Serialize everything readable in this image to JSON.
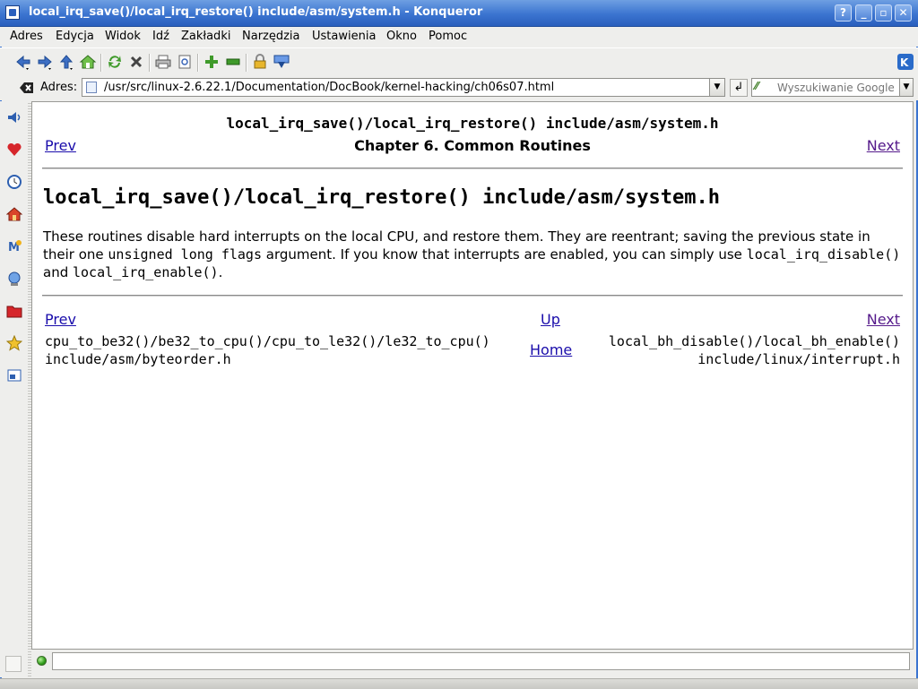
{
  "window": {
    "title": "local_irq_save()/local_irq_restore() include/asm/system.h - Konqueror",
    "buttons": {
      "help": "?",
      "minimize": "_",
      "maximize": "▫",
      "close": "✕"
    }
  },
  "menu": [
    {
      "label": "Adres"
    },
    {
      "label": "Edycja"
    },
    {
      "label": "Widok"
    },
    {
      "label": "Idź"
    },
    {
      "label": "Zakładki"
    },
    {
      "label": "Narzędzia"
    },
    {
      "label": "Ustawienia"
    },
    {
      "label": "Okno"
    },
    {
      "label": "Pomoc"
    }
  ],
  "location": {
    "label": "Adres:",
    "url": "/usr/src/linux-2.6.22.1/Documentation/DocBook/kernel-hacking/ch06s07.html",
    "search_placeholder": "Wyszukiwanie Google"
  },
  "page": {
    "header_title": "local_irq_save()/local_irq_restore() include/asm/system.h",
    "nav_prev": "Prev",
    "chapter": "Chapter 6. Common Routines",
    "nav_next": "Next",
    "heading": "local_irq_save()/local_irq_restore() include/asm/system.h",
    "para": {
      "t1": "These routines disable hard interrupts on the local CPU, and restore them. They are reentrant; saving the previous state in their one ",
      "code1": "unsigned long flags",
      "t2": " argument. If you know that interrupts are enabled, you can simply use ",
      "code2": "local_irq_disable()",
      "t3": " and ",
      "code3": "local_irq_enable()",
      "t4": "."
    },
    "footer": {
      "prev": "Prev",
      "up": "Up",
      "next": "Next",
      "prev_title_1": "cpu_to_be32()/be32_to_cpu()/cpu_to_le32()/le32_to_cpu()",
      "prev_title_2": "include/asm/byteorder.h",
      "home": "Home",
      "next_title_1": "local_bh_disable()/local_bh_enable()",
      "next_title_2": "include/linux/interrupt.h"
    }
  },
  "colors": {
    "titlebar": "#3b74d0",
    "link": "#1a0dab",
    "visited_link": "#551a8b"
  }
}
